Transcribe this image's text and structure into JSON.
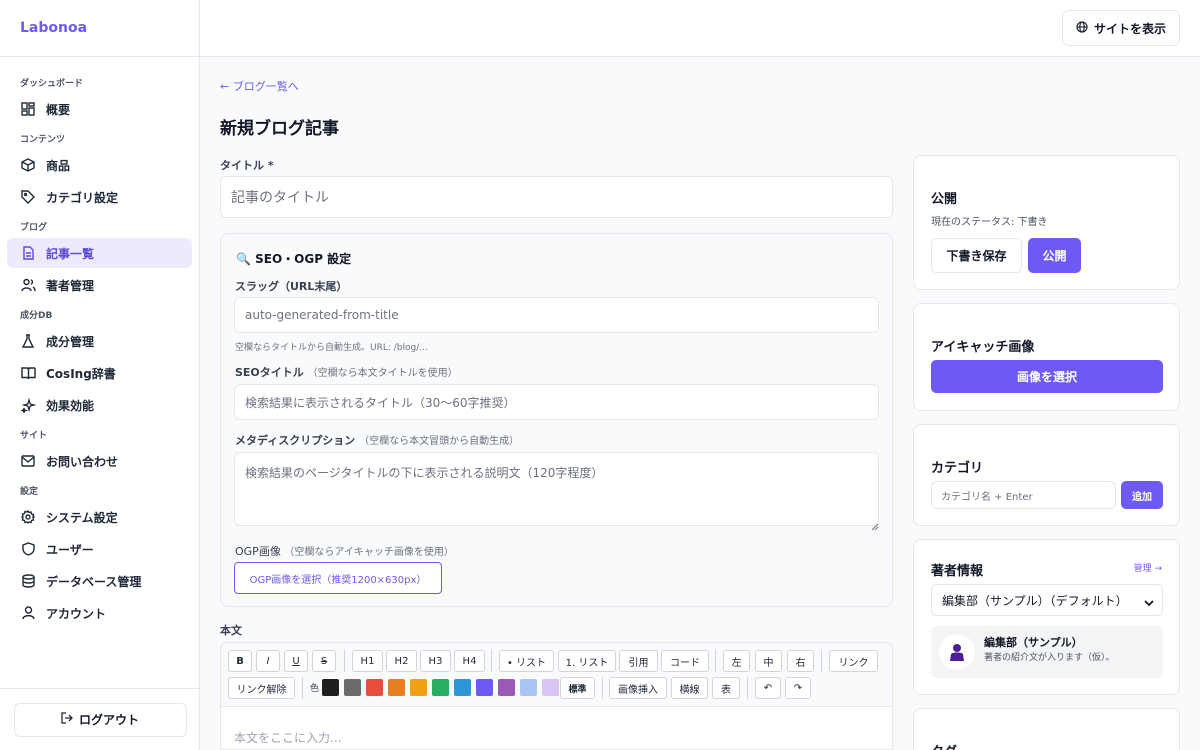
{
  "app": {
    "brand": "Labonoa"
  },
  "sidebar": {
    "sections": [
      {
        "title": "ダッシュボード",
        "items": [
          {
            "label": "概要",
            "icon": "dashboard-icon"
          }
        ]
      },
      {
        "title": "コンテンツ",
        "items": [
          {
            "label": "商品",
            "icon": "box-icon"
          },
          {
            "label": "カテゴリ設定",
            "icon": "tag-icon"
          }
        ]
      },
      {
        "title": "ブログ",
        "items": [
          {
            "label": "記事一覧",
            "icon": "document-icon",
            "active": true
          },
          {
            "label": "著者管理",
            "icon": "users-icon"
          }
        ]
      },
      {
        "title": "成分DB",
        "items": [
          {
            "label": "成分管理",
            "icon": "flask-icon"
          },
          {
            "label": "CosIng辞書",
            "icon": "book-icon"
          }
        ]
      },
      {
        "items": [
          {
            "label": "効果効能",
            "icon": "sparkle-icon"
          }
        ]
      },
      {
        "title": "サイト",
        "items": [
          {
            "label": "お問い合わせ",
            "icon": "mail-icon"
          }
        ]
      },
      {
        "title": "設定",
        "items": [
          {
            "label": "システム設定",
            "icon": "gear-icon"
          },
          {
            "label": "ユーザー",
            "icon": "shield-icon"
          },
          {
            "label": "データベース管理",
            "icon": "database-icon"
          },
          {
            "label": "アカウント",
            "icon": "user-icon"
          }
        ]
      }
    ],
    "logout_label": "ログアウト"
  },
  "topbar": {
    "view_site_label": "サイトを表示"
  },
  "page": {
    "back_link": "← ブログ一覧へ",
    "title": "新規ブログ記事"
  },
  "form": {
    "title_label": "タイトル *",
    "title_placeholder": "記事のタイトル",
    "seo": {
      "heading": "🔍 SEO・OGP 設定",
      "slug_label": "スラッグ（URL末尾）",
      "slug_placeholder": "auto-generated-from-title",
      "slug_help": "空欄ならタイトルから自動生成。URL: /blog/...",
      "seo_title_label": "SEOタイトル",
      "seo_title_hint": "（空欄なら本文タイトルを使用）",
      "seo_title_placeholder": "検索結果に表示されるタイトル（30〜60字推奨）",
      "meta_label": "メタディスクリプション",
      "meta_hint": "（空欄なら本文冒頭から自動生成）",
      "meta_placeholder": "検索結果のページタイトルの下に表示される説明文（120字程度）",
      "ogp_label": "OGP画像",
      "ogp_hint": "（空欄ならアイキャッチ画像を使用）",
      "ogp_button": "OGP画像を選択（推奨1200×630px）"
    },
    "body_label": "本文",
    "body_placeholder": "本文をここに入力..."
  },
  "toolbar": {
    "bold": "B",
    "italic": "I",
    "underline": "U",
    "strike": "S",
    "h1": "H1",
    "h2": "H2",
    "h3": "H3",
    "h4": "H4",
    "bullet": "• リスト",
    "numbered": "1. リスト",
    "quote": "引用",
    "code": "コード",
    "left": "左",
    "center": "中",
    "right": "右",
    "link": "リンク",
    "unlink": "リンク解除",
    "color_label": "色",
    "colors": [
      "#1f1f1f",
      "#6b6b6b",
      "#e74c3c",
      "#e67e22",
      "#f1a10f",
      "#27ae60",
      "#2b95d6",
      "#6d5af5",
      "#9b59b6",
      "#a9c4f5",
      "#d6c5f5"
    ],
    "standard": "標準",
    "insert_image": "画像挿入",
    "hr": "横線",
    "table": "表",
    "undo": "↶",
    "redo": "↷"
  },
  "publish": {
    "heading": "公開",
    "status": "現在のステータス: 下書き",
    "draft_button": "下書き保存",
    "publish_button": "公開"
  },
  "eyecatch": {
    "heading": "アイキャッチ画像",
    "button": "画像を選択"
  },
  "category": {
    "heading": "カテゴリ",
    "placeholder": "カテゴリ名 + Enter",
    "add_button": "追加"
  },
  "author": {
    "heading": "著者情報",
    "manage_link": "管理 →",
    "select_value": "編集部（サンプル）（デフォルト）",
    "name": "編集部（サンプル）",
    "bio": "著者の紹介文が入ります（仮）。"
  },
  "tags": {
    "heading": "タグ"
  },
  "colors": {
    "accent": "#6d5af5"
  }
}
